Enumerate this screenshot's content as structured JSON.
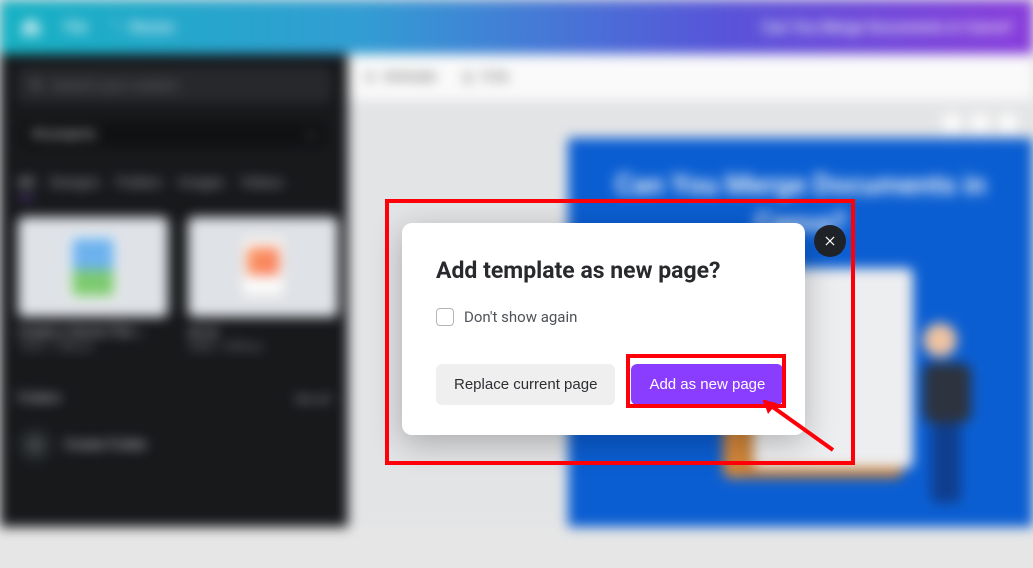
{
  "colors": {
    "accent_purple": "#8b3dff",
    "danger_annot": "#ff0008",
    "doc_blue": "#0b60d6"
  },
  "topbar": {
    "file_label": "File",
    "resize_label": "Resize",
    "title_right": "Can You Merge Documents in Canva?"
  },
  "sidebar": {
    "search_placeholder": "Search your content",
    "projects_dropdown": "All projects",
    "tabs": {
      "all": "All",
      "designs": "Designs",
      "folders": "Folders",
      "images": "Images",
      "videos": "Videos"
    },
    "items": [
      {
        "title": "Create a Vector File i…",
        "sub": "1920 × 1080 px"
      },
      {
        "title": "art.ai",
        "sub": "2480 × 3508 px"
      }
    ],
    "folders_label": "Folders",
    "see_all_label": "See all",
    "create_folder_label": "Create Folder"
  },
  "toolbar": {
    "animate": "Animate",
    "timer": "5.0s"
  },
  "document": {
    "title": "Can You Merge Documents in Canva?"
  },
  "modal": {
    "title": "Add template as new page?",
    "dont_show": "Don't show again",
    "replace_label": "Replace current page",
    "add_label": "Add as new page"
  }
}
